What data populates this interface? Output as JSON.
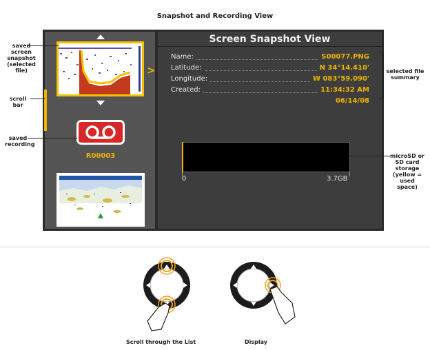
{
  "heading": "Snapshot and Recording View",
  "screen": {
    "title": "Screen Snapshot View",
    "file_info": {
      "name_label": "Name:",
      "name_value": "S00077.PNG",
      "latitude_label": "Latitude:",
      "latitude_value": "N 34°14.410'",
      "longitude_label": "Longitude:",
      "longitude_value": "W 083°59.090'",
      "created_label": "Created:",
      "created_time": "11:34:32 AM",
      "created_date": "06/14/08"
    },
    "storage": {
      "min_label": "0",
      "max_label": "3.7GB",
      "used_fraction": 0.01
    },
    "recording_label": "R00003",
    "colors": {
      "accent": "#f0b400",
      "recording": "#d62828",
      "panel": "#545454"
    }
  },
  "callouts": {
    "snapshot": [
      "saved",
      "screen",
      "snapshot",
      "(selected",
      "file)"
    ],
    "scroll": "scroll bar",
    "recording": [
      "saved",
      "recording"
    ],
    "summary": [
      "selected file",
      "summary"
    ],
    "storage": [
      "microSD or",
      "SD card",
      "storage",
      "(yellow =",
      "used space)"
    ]
  },
  "captions": {
    "scroll_list": "Scroll through the List",
    "display": "Display"
  },
  "icons": [
    "arrow-up-icon",
    "arrow-down-icon",
    "chevron-right-icon",
    "recording-icon",
    "dial-icon",
    "hand-icon"
  ]
}
